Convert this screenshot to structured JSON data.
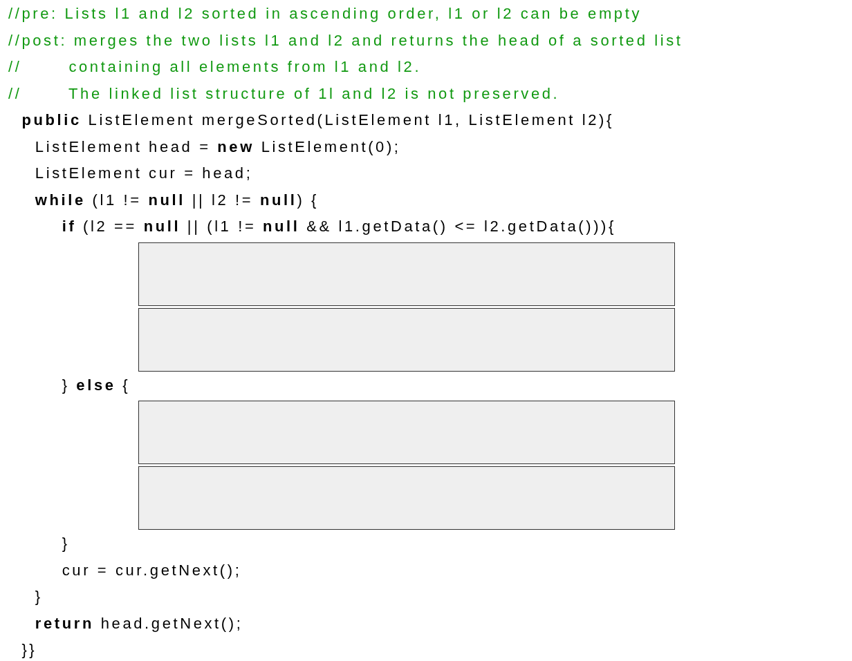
{
  "listing": [
    {
      "kind": "comment",
      "text": "//pre: Lists l1 and l2 sorted in ascending order, l1 or l2 can be empty"
    },
    {
      "kind": "comment",
      "text": "//post: merges the two lists l1 and l2 and returns the head of a sorted list"
    },
    {
      "kind": "comment",
      "text": "//       containing all elements from l1 and l2."
    },
    {
      "kind": "comment",
      "text": "//       The linked list structure of 1l and l2 is not preserved."
    },
    {
      "kind": "code",
      "text": "  **public** ListElement mergeSorted(ListElement l1, ListElement l2){"
    },
    {
      "kind": "code",
      "text": "    ListElement head = **new** ListElement(0);"
    },
    {
      "kind": "code",
      "text": "    ListElement cur = head;"
    },
    {
      "kind": "code",
      "text": "    **while** (l1 != **null** || l2 != **null**) {"
    },
    {
      "kind": "code",
      "text": "        **if** (l2 == **null** || (l1 != **null** && l1.getData() <= l2.getData())){"
    },
    {
      "kind": "answer"
    },
    {
      "kind": "answer"
    },
    {
      "kind": "code",
      "text": "        } **else** {"
    },
    {
      "kind": "answer"
    },
    {
      "kind": "answer"
    },
    {
      "kind": "code",
      "text": "        }"
    },
    {
      "kind": "code",
      "text": "        cur = cur.getNext();"
    },
    {
      "kind": "code",
      "text": "    }"
    },
    {
      "kind": "code",
      "text": "    **return** head.getNext();"
    },
    {
      "kind": "code",
      "text": "  }}"
    }
  ]
}
